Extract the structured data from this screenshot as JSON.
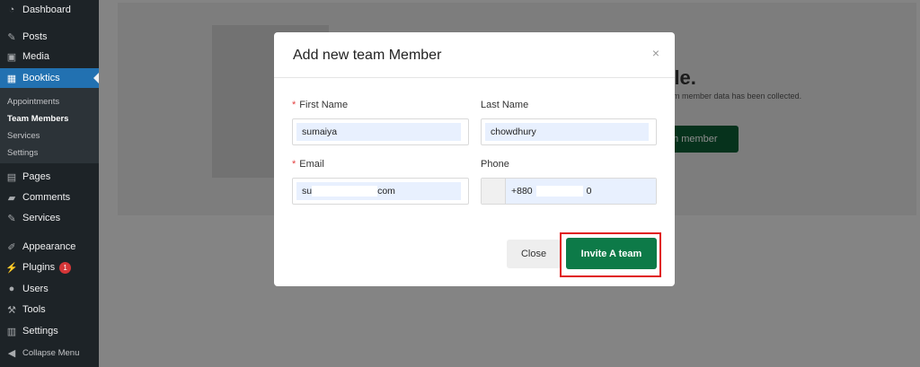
{
  "sidebar": {
    "items": [
      {
        "label": "Dashboard",
        "icon": "dashboard-icon"
      },
      {
        "label": "Posts",
        "icon": "pin-icon"
      },
      {
        "label": "Media",
        "icon": "media-icon"
      },
      {
        "label": "Booktics",
        "icon": "calendar-icon"
      },
      {
        "label": "Pages",
        "icon": "page-icon"
      },
      {
        "label": "Comments",
        "icon": "comment-icon"
      },
      {
        "label": "Services",
        "icon": "pin-icon"
      },
      {
        "label": "Appearance",
        "icon": "brush-icon"
      },
      {
        "label": "Plugins",
        "icon": "plugin-icon",
        "badge": "1"
      },
      {
        "label": "Users",
        "icon": "user-icon"
      },
      {
        "label": "Tools",
        "icon": "wrench-icon"
      },
      {
        "label": "Settings",
        "icon": "settings-icon"
      },
      {
        "label": "Collapse Menu",
        "icon": "collapse-icon"
      }
    ],
    "submenu": [
      "Appointments",
      "Team Members",
      "Services",
      "Settings"
    ]
  },
  "background": {
    "title_fragment": "ble.",
    "subtitle_fragment": "am member data has been collected.",
    "button_fragment": "m member"
  },
  "modal": {
    "title": "Add new team Member",
    "close_glyph": "×",
    "first_name_label": "First Name",
    "first_name_value": "sumaiya",
    "last_name_label": "Last Name",
    "last_name_value": "chowdhury",
    "email_label": "Email",
    "email_value_start": "su",
    "email_value_end": "com",
    "phone_label": "Phone",
    "phone_value_start": "+880",
    "phone_value_end": "0",
    "required_mark": "*",
    "close_button": "Close",
    "invite_button": "Invite A team"
  },
  "colors": {
    "sidebar_bg": "#1d2327",
    "active_blue": "#2271b1",
    "invite_green": "#0d7a48",
    "highlight_red": "#e01616"
  }
}
